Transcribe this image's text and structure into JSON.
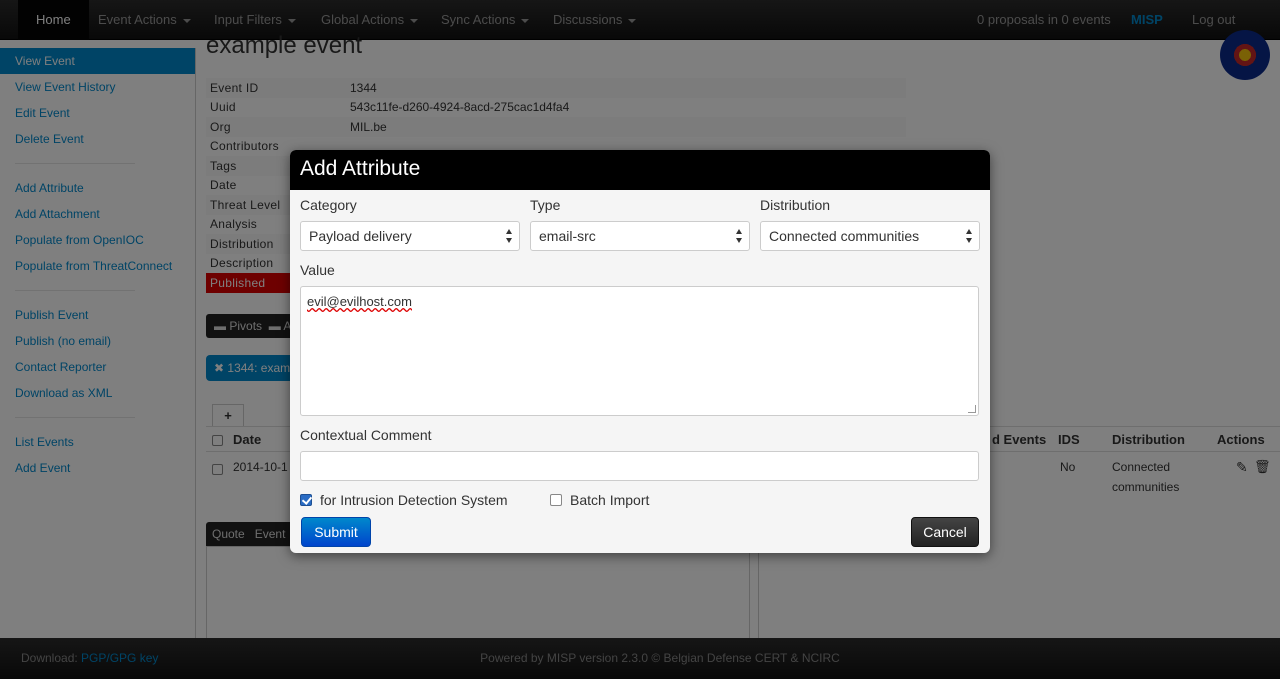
{
  "navbar": {
    "home": "Home",
    "menus": [
      "Event Actions",
      "Input Filters",
      "Global Actions",
      "Sync Actions",
      "Discussions"
    ],
    "proposals": "0 proposals in 0 events",
    "brand": "MISP",
    "logout": "Log out"
  },
  "sidebar": {
    "group1": [
      "View Event",
      "View Event History",
      "Edit Event",
      "Delete Event"
    ],
    "group2": [
      "Add Attribute",
      "Add Attachment",
      "Populate from OpenIOC",
      "Populate from ThreatConnect"
    ],
    "group3": [
      "Publish Event",
      "Publish (no email)",
      "Contact Reporter",
      "Download as XML"
    ],
    "group4": [
      "List Events",
      "Add Event"
    ]
  },
  "event": {
    "title": "example event",
    "details": [
      {
        "key": "Event ID",
        "value": "1344"
      },
      {
        "key": "Uuid",
        "value": "543c11fe-d260-4924-8acd-275cac1d4fa4"
      },
      {
        "key": "Org",
        "value": "MIL.be"
      },
      {
        "key": "Contributors",
        "value": ""
      },
      {
        "key": "Tags",
        "value": ""
      },
      {
        "key": "Date",
        "value": ""
      },
      {
        "key": "Threat Level",
        "value": ""
      },
      {
        "key": "Analysis",
        "value": ""
      },
      {
        "key": "Distribution",
        "value": ""
      },
      {
        "key": "Description",
        "value": ""
      }
    ],
    "published_label": "Published",
    "pivots_label": "Pivots",
    "pivots_second": "A",
    "pivot_pill": "1344: exam",
    "plus_tab": "+",
    "columns": {
      "date": "Date",
      "related": "d Events",
      "ids": "IDS",
      "distribution": "Distribution",
      "actions": "Actions"
    },
    "row": {
      "date": "2014-10-1",
      "ids": "No",
      "distribution": "Connected communities"
    },
    "quote_tabs": [
      "Quote",
      "Event"
    ]
  },
  "modal": {
    "title": "Add Attribute",
    "category_label": "Category",
    "category_value": "Payload delivery",
    "type_label": "Type",
    "type_value": "email-src",
    "distribution_label": "Distribution",
    "distribution_value": "Connected communities",
    "value_label": "Value",
    "value_text": "evil@evilhost.com",
    "comment_label": "Contextual Comment",
    "comment_value": "",
    "ids_label": "for Intrusion Detection System",
    "ids_checked": true,
    "batch_label": "Batch Import",
    "batch_checked": false,
    "submit": "Submit",
    "cancel": "Cancel"
  },
  "footer": {
    "download_prefix": "Download:",
    "download_link": "PGP/GPG key",
    "powered": "Powered by MISP version 2.3.0 © Belgian Defense CERT & NCIRC"
  }
}
